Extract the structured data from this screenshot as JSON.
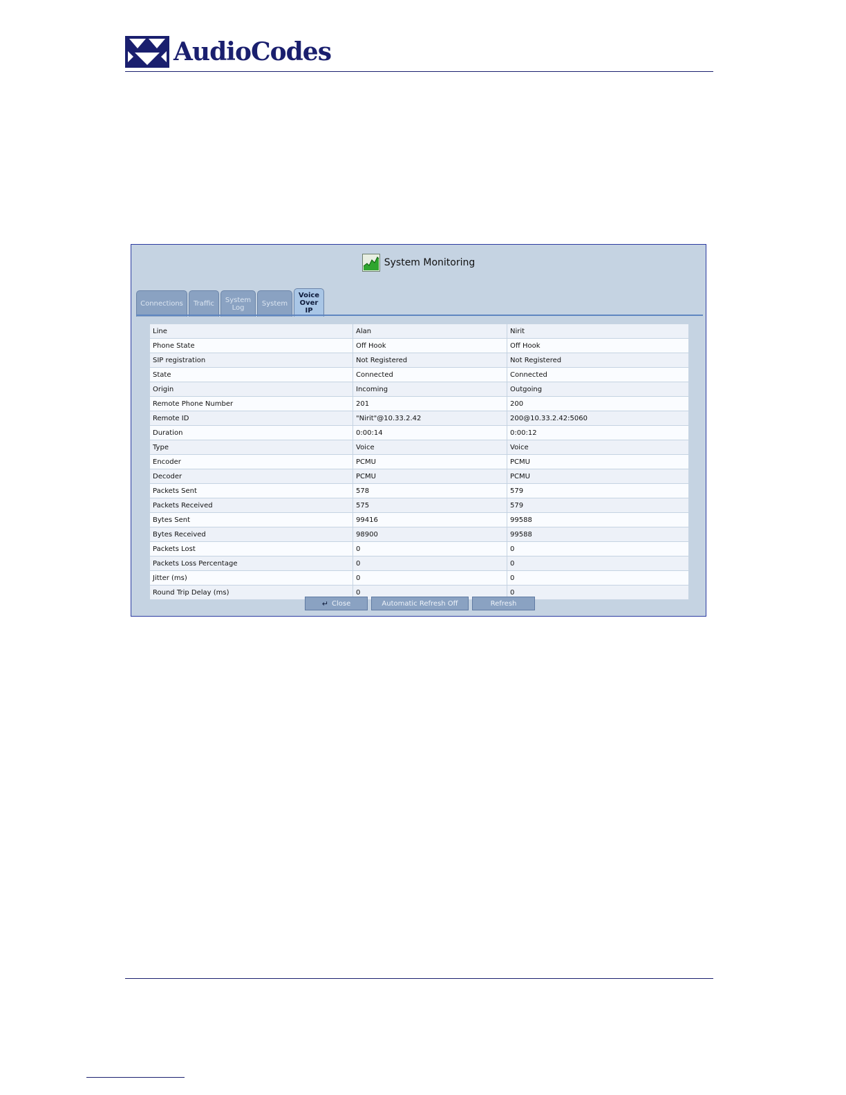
{
  "brand": {
    "name": "AudioCodes",
    "color": "#1a1f6e"
  },
  "window": {
    "title": "System Monitoring",
    "icon": "chart-monitor-icon"
  },
  "tabs": [
    {
      "label": "Connections",
      "active": false
    },
    {
      "label": "Traffic",
      "active": false
    },
    {
      "label": "System Log",
      "active": false
    },
    {
      "label": "System",
      "active": false
    },
    {
      "label": "Voice Over IP",
      "active": true
    }
  ],
  "table": {
    "rows": [
      [
        "Line",
        "Alan",
        "Nirit"
      ],
      [
        "Phone State",
        "Off Hook",
        "Off Hook"
      ],
      [
        "SIP registration",
        "Not Registered",
        "Not Registered"
      ],
      [
        "State",
        "Connected",
        "Connected"
      ],
      [
        "Origin",
        "Incoming",
        "Outgoing"
      ],
      [
        "Remote Phone Number",
        "201",
        "200"
      ],
      [
        "Remote ID",
        "\"Nirit\"@10.33.2.42",
        "200@10.33.2.42:5060"
      ],
      [
        "Duration",
        "0:00:14",
        "0:00:12"
      ],
      [
        "Type",
        "Voice",
        "Voice"
      ],
      [
        "Encoder",
        "PCMU",
        "PCMU"
      ],
      [
        "Decoder",
        "PCMU",
        "PCMU"
      ],
      [
        "Packets Sent",
        "578",
        "579"
      ],
      [
        "Packets Received",
        "575",
        "579"
      ],
      [
        "Bytes Sent",
        "99416",
        "99588"
      ],
      [
        "Bytes Received",
        "98900",
        "99588"
      ],
      [
        "Packets Lost",
        "0",
        "0"
      ],
      [
        "Packets Loss Percentage",
        "0",
        "0"
      ],
      [
        "Jitter (ms)",
        "0",
        "0"
      ],
      [
        "Round Trip Delay (ms)",
        "0",
        "0"
      ]
    ]
  },
  "buttons": {
    "close": {
      "label": "Close",
      "icon": "return-arrow-icon"
    },
    "auto_refresh": {
      "label": "Automatic Refresh Off"
    },
    "refresh": {
      "label": "Refresh"
    }
  }
}
